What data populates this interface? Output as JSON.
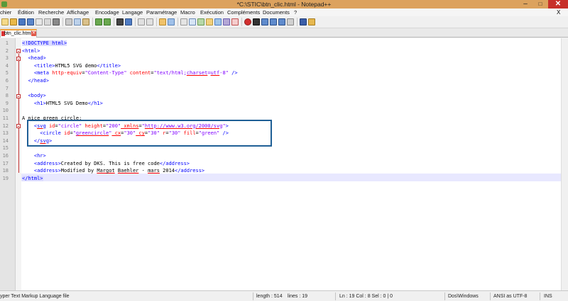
{
  "window": {
    "title": "*C:\\STIC\\btn_clic.html - Notepad++",
    "minimize": "–",
    "maximize": "□",
    "close": "✕"
  },
  "menu": [
    "chier",
    "Édition",
    "Recherche",
    "Affichage",
    "Encodage",
    "Langage",
    "Paramétrage",
    "Macro",
    "Exécution",
    "Compléments",
    "Documents",
    "?"
  ],
  "menu_close": "X",
  "tab": {
    "label": "btn_clic.html",
    "close": "✕"
  },
  "lines": [
    "1",
    "2",
    "3",
    "4",
    "5",
    "6",
    "7",
    "8",
    "9",
    "10",
    "11",
    "12",
    "13",
    "14",
    "15",
    "16",
    "17",
    "18",
    "19"
  ],
  "code": {
    "l1": "<!DOCTYPE html>",
    "l2": "<html>",
    "l3": "<head>",
    "l4_open": "<title>",
    "l4_text": "HTML5 SVG demo",
    "l4_close": "</title>",
    "l5_tag": "<meta ",
    "l5_a1": "http-equiv",
    "l5_v1": "\"Content-Type\"",
    "l5_a2": " content",
    "l5_v2a": "\"text/html;",
    "l5_v2b": "charset",
    "l5_v2c": "=",
    "l5_v2d": "utf",
    "l5_v2e": "-8\"",
    "l5_end": " />",
    "l6": "</head>",
    "l8": "<body>",
    "l9_open": "<h1>",
    "l9_text": "HTML5 SVG Demo",
    "l9_close": "</h1>",
    "l11": "A nice green circle:",
    "l12_tag": "<",
    "l12_svg": "svg",
    "l12_a1": " id",
    "l12_v1": "\"circle\"",
    "l12_a2": " height",
    "l12_v2": "\"200\"",
    "l12_a3": " xmlns",
    "l12_v3a": "\"",
    "l12_v3b": "http://www.w3.org/2000/svg",
    "l12_v3c": "\"",
    "l12_end": ">",
    "l13_tag": "<circle",
    "l13_a1": " id",
    "l13_v1a": "\"",
    "l13_v1b": "greencircle",
    "l13_v1c": "\"",
    "l13_a2": " cx",
    "l13_v2": "\"30\"",
    "l13_a3": " cy",
    "l13_v3": "\"30\"",
    "l13_a4": " r",
    "l13_v4": "\"30\"",
    "l13_a5": " fill",
    "l13_v5": "\"green\"",
    "l13_end": " />",
    "l14_a": "</",
    "l14_svg": "svg",
    "l14_b": ">",
    "l16": "<hr>",
    "l17_open": "<address>",
    "l17_text": "Created by DKS. This is free code",
    "l17_close": "</address>",
    "l18_open": "<address>",
    "l18_t1": "Modified by ",
    "l18_t2": "Margot",
    "l18_t3": " ",
    "l18_t4": "Baehler",
    "l18_t5": " - ",
    "l18_t6": "mars",
    "l18_t7": " 2014",
    "l18_close": "</address>",
    "l19": "</html>"
  },
  "status": {
    "filetype": "yper Text Markup Language file",
    "length": "length : 514",
    "lines": "lines : 19",
    "position": "Ln : 19   Col : 8   Sel : 0 | 0",
    "eol": "Dos\\Windows",
    "encoding": "ANSI as UTF-8",
    "mode": "INS"
  },
  "colors": {
    "titlebar": "#dca25e",
    "close": "#c7302a",
    "tag": "#0000ff",
    "attr": "#ff0000",
    "value": "#8000ff",
    "selection_box": "#1f5f96"
  }
}
